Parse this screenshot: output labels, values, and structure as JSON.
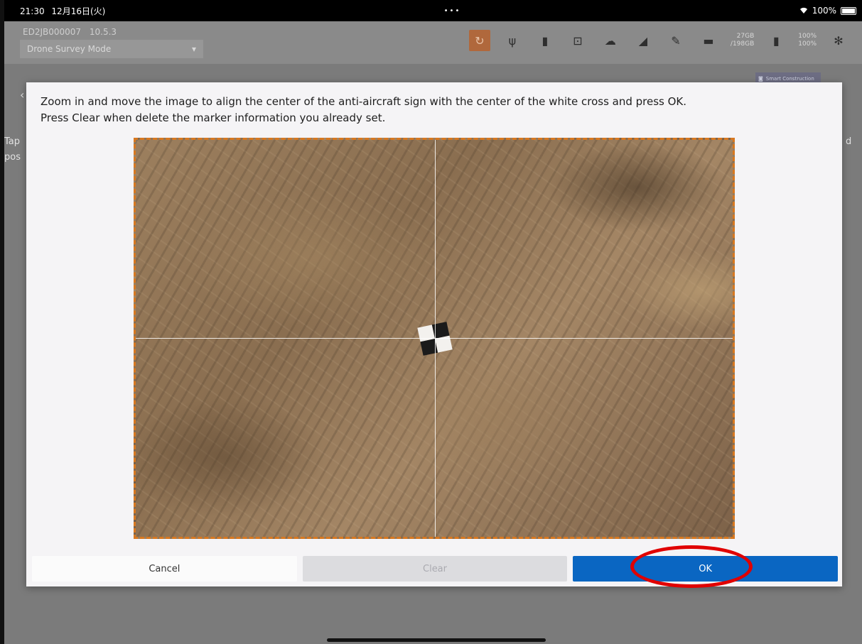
{
  "status_bar": {
    "time": "21:30",
    "date": "12月16日(火)",
    "center_indicator": "•••",
    "battery_text": "100%"
  },
  "app_header": {
    "device_id": "ED2JB000007",
    "version": "10.5.3",
    "mode_select": "Drone Survey Mode",
    "storage_free": "27GB",
    "storage_total": "/198GB",
    "battery_top": "100%",
    "battery_bottom": "100%",
    "logo_text": "Smart Construction"
  },
  "background": {
    "left_fragment_1": "Tap",
    "left_fragment_2": "pos",
    "right_fragment": "d"
  },
  "dialog": {
    "instruction_line1": "Zoom in and move the image to align the center of the anti-aircraft sign with the center of the white cross and press OK.",
    "instruction_line2": "Press Clear when delete the marker information you already set.",
    "cancel_label": "Cancel",
    "clear_label": "Clear",
    "ok_label": "OK",
    "colors": {
      "ok": "#0a66c2",
      "photo_border": "#d87820",
      "highlight": "#e00000"
    }
  }
}
